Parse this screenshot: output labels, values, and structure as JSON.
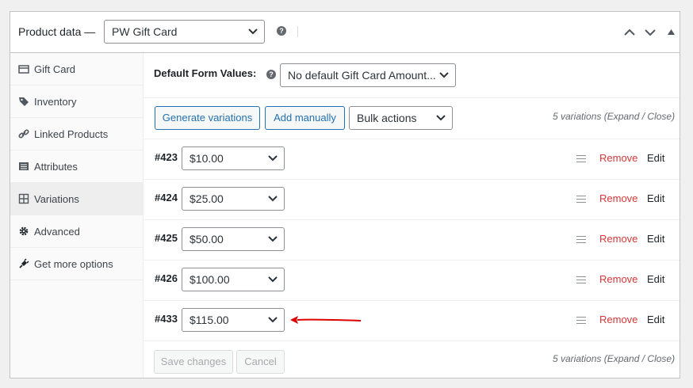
{
  "header": {
    "title": "Product data —",
    "product_type": {
      "selected": "PW Gift Card"
    }
  },
  "tabs": [
    {
      "label": "Gift Card",
      "icon": "card-icon",
      "active": false
    },
    {
      "label": "Inventory",
      "icon": "tag-icon",
      "active": false
    },
    {
      "label": "Linked Products",
      "icon": "link-icon",
      "active": false
    },
    {
      "label": "Attributes",
      "icon": "list-icon",
      "active": false
    },
    {
      "label": "Variations",
      "icon": "grid-icon",
      "active": true
    },
    {
      "label": "Advanced",
      "icon": "gear-icon",
      "active": false
    },
    {
      "label": "Get more options",
      "icon": "plug-icon",
      "active": false
    }
  ],
  "defaults": {
    "label": "Default Form Values:",
    "amount_select": "No default Gift Card Amount..."
  },
  "toolbar": {
    "generate": "Generate variations",
    "add_manually": "Add manually",
    "bulk_actions": "Bulk actions",
    "count_text": "5 variations (Expand / Close)"
  },
  "variations": [
    {
      "id": "#423",
      "amount": "$10.00",
      "remove": "Remove",
      "edit": "Edit"
    },
    {
      "id": "#424",
      "amount": "$25.00",
      "remove": "Remove",
      "edit": "Edit"
    },
    {
      "id": "#425",
      "amount": "$50.00",
      "remove": "Remove",
      "edit": "Edit"
    },
    {
      "id": "#426",
      "amount": "$100.00",
      "remove": "Remove",
      "edit": "Edit"
    },
    {
      "id": "#433",
      "amount": "$115.00",
      "remove": "Remove",
      "edit": "Edit"
    }
  ],
  "footer": {
    "save": "Save changes",
    "cancel": "Cancel",
    "count_text": "5 variations (Expand / Close)"
  },
  "colors": {
    "accent": "#2271b1",
    "remove": "#d63638",
    "annotation_arrow": "#e00000"
  }
}
